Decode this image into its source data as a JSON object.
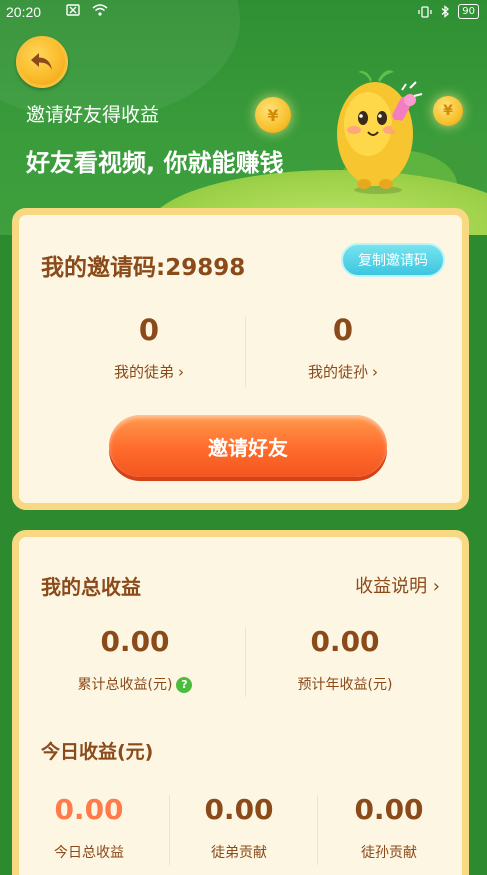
{
  "status_bar": {
    "time": "20:20",
    "battery": "90"
  },
  "header": {
    "subtitle": "邀请好友得收益",
    "title": "好友看视频, 你就能赚钱",
    "coin_symbol": "¥"
  },
  "invite_card": {
    "invite_code_label": "我的邀请码:",
    "invite_code": "29898",
    "copy_button": "复制邀请码",
    "disciples_count": "0",
    "disciples_label": "我的徒弟",
    "grand_disciples_count": "0",
    "grand_disciples_label": "我的徒孙",
    "invite_button": "邀请好友"
  },
  "earnings_card": {
    "title": "我的总收益",
    "explain_link": "收益说明",
    "total_value": "0.00",
    "total_label": "累计总收益(元)",
    "annual_value": "0.00",
    "annual_label": "预计年收益(元)",
    "today_title": "今日收益(元)",
    "today_total_value": "0.00",
    "today_total_label": "今日总收益",
    "disciple_contrib_value": "0.00",
    "disciple_contrib_label": "徒弟贡献",
    "grand_contrib_value": "0.00",
    "grand_contrib_label": "徒孙贡献"
  },
  "colors": {
    "brand_green": "#2d8a2f",
    "text_brown": "#8a4a1a",
    "accent_orange": "#ff6b2c",
    "copy_cyan": "#3cc6e0"
  }
}
